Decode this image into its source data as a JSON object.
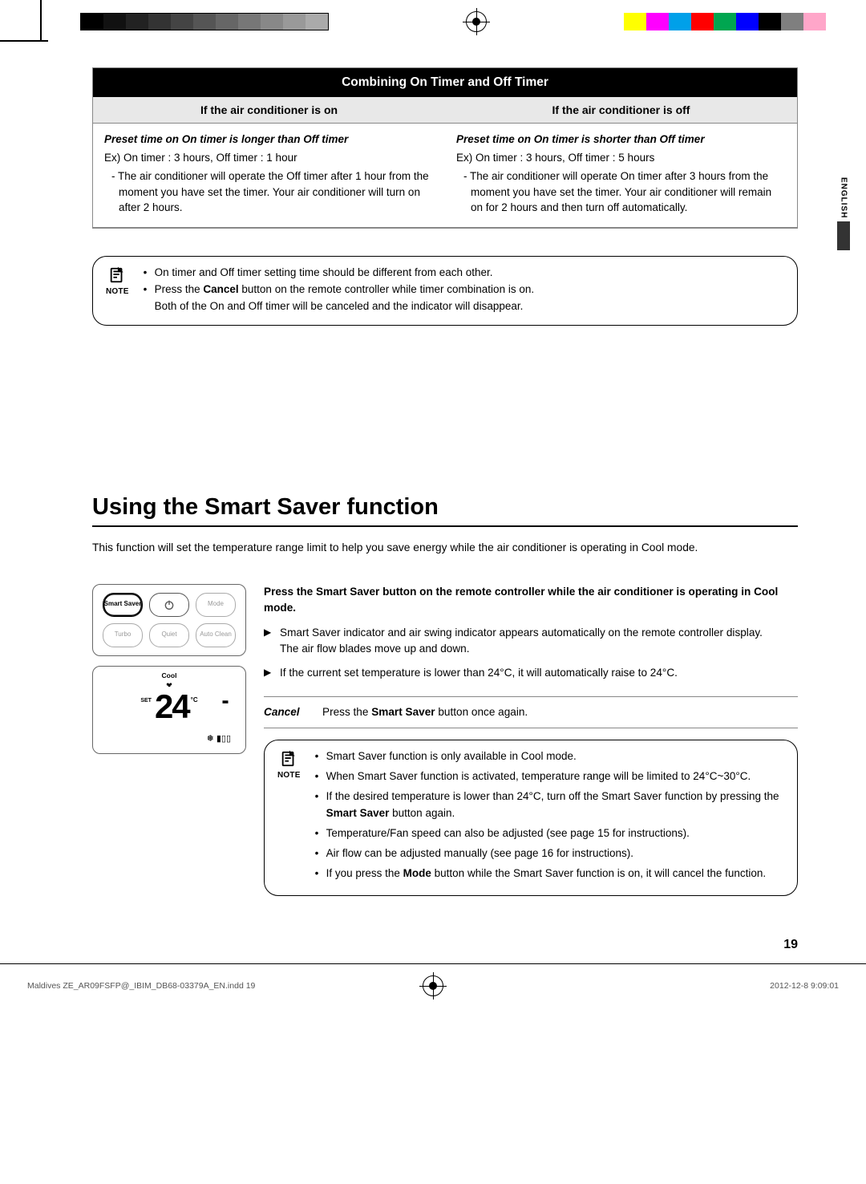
{
  "calibration": {
    "grays": [
      "#000000",
      "#111111",
      "#222222",
      "#333333",
      "#444444",
      "#555555",
      "#666666",
      "#777777",
      "#888888",
      "#999999",
      "#aaaaaa"
    ],
    "colors": [
      "#ffff00",
      "#ff00ff",
      "#00a0e9",
      "#ff0000",
      "#00a650",
      "#0000ff",
      "#000000",
      "#7f7f7f",
      "#ffa6c9"
    ]
  },
  "sideTab": {
    "language": "ENGLISH"
  },
  "timerTable": {
    "title": "Combining On Timer and Off Timer",
    "headers": [
      "If the air conditioner is on",
      "If the air conditioner is off"
    ],
    "left": {
      "preset": "Preset time on On timer is longer than Off timer",
      "ex": "Ex) On timer : 3 hours, Off timer : 1 hour",
      "dash": "- The air conditioner will operate the Off timer after 1 hour from the moment you have set the timer. Your air conditioner will turn on after 2 hours."
    },
    "right": {
      "preset": "Preset time on On timer is shorter than Off timer",
      "ex": "Ex) On timer : 3 hours, Off timer : 5 hours",
      "dash": "- The air conditioner will operate On timer after 3 hours from the moment you have set the timer. Your air conditioner will remain on for 2 hours and then turn off automatically."
    }
  },
  "note1": {
    "label": "NOTE",
    "items": [
      {
        "text": "On timer and Off timer setting time should be different from each other."
      },
      {
        "text": "Press the ",
        "bold": "Cancel",
        "text2": " button on the remote controller while timer combination is on.",
        "sub": "Both of the On and Off timer will be canceled and the indicator will disappear."
      }
    ]
  },
  "section": {
    "title": "Using the Smart Saver function",
    "intro": "This function will set the temperature range limit to help you save energy while the air conditioner is operating in Cool mode."
  },
  "remote": {
    "buttons": {
      "smartSaver": "Smart Saver",
      "mode": "Mode",
      "turbo": "Turbo",
      "quiet": "Quiet",
      "autoClean": "Auto Clean"
    },
    "display": {
      "mode": "Cool",
      "set": "SET",
      "temp": "24",
      "unit": "°C"
    }
  },
  "instructions": {
    "leadA": "Press the ",
    "leadBold": "Smart Saver",
    "leadB": " button on the remote controller while the air conditioner is operating in Cool mode.",
    "arrows": [
      "Smart Saver indicator and air swing indicator appears automatically on the remote controller display.\nThe air flow blades move up and down.",
      "If the current set temperature is lower than 24°C, it will automatically raise to 24°C."
    ],
    "cancel": {
      "label": "Cancel",
      "textA": "Press the ",
      "bold": "Smart Saver",
      "textB": " button once again."
    }
  },
  "note2": {
    "label": "NOTE",
    "items": [
      "Smart Saver function is only available in Cool mode.",
      "When Smart Saver function is activated, temperature range will be limited to 24°C~30°C.",
      {
        "pre": "If the desired temperature is lower than 24°C, turn off the Smart Saver function by pressing the ",
        "bold": "Smart Saver",
        "post": " button again."
      },
      "Temperature/Fan speed can also be adjusted (see page 15 for instructions).",
      "Air flow can be adjusted manually (see page 16 for instructions).",
      {
        "pre": "If you press the ",
        "bold": "Mode",
        "post": " button while the Smart Saver function is on, it will cancel the function."
      }
    ]
  },
  "pageNumber": "19",
  "footer": {
    "left": "Maldives ZE_AR09FSFP@_IBIM_DB68-03379A_EN.indd   19",
    "right": "2012-12-8   9:09:01"
  }
}
